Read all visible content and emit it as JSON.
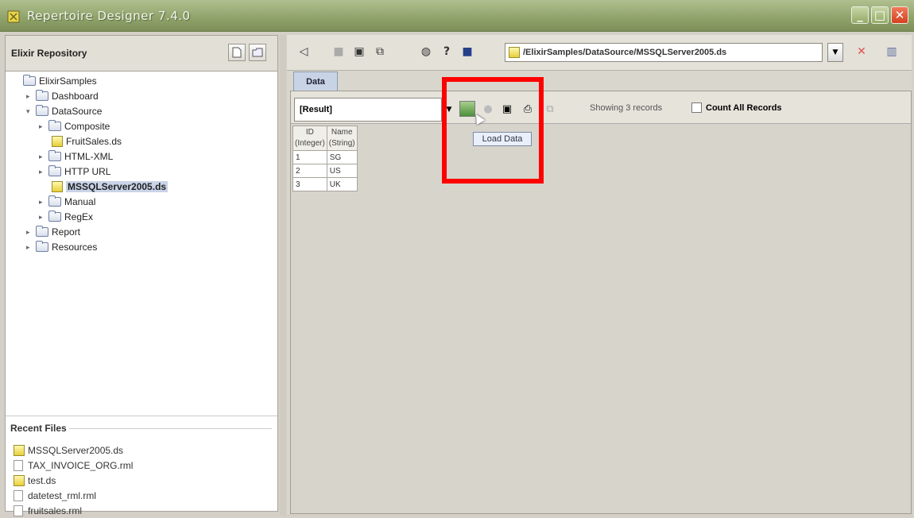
{
  "window": {
    "title": "Repertoire Designer 7.4.0",
    "controls": {
      "minimize": "_",
      "maximize": "□",
      "close": "✕"
    }
  },
  "left_panel": {
    "header": "Elixir Repository",
    "tree": [
      {
        "label": "ElixirSamples",
        "level": 0,
        "type": "folder",
        "expanded": true
      },
      {
        "label": "Dashboard",
        "level": 1,
        "type": "folder",
        "expanded": false
      },
      {
        "label": "DataSource",
        "level": 1,
        "type": "folder",
        "expanded": true
      },
      {
        "label": "Composite",
        "level": 2,
        "type": "folder",
        "expanded": false
      },
      {
        "label": "FruitSales.ds",
        "level": 3,
        "type": "ds"
      },
      {
        "label": "HTML-XML",
        "level": 2,
        "type": "folder",
        "expanded": false
      },
      {
        "label": "HTTP URL",
        "level": 2,
        "type": "folder",
        "expanded": false
      },
      {
        "label": "MSSQLServer2005.ds",
        "level": 3,
        "type": "ds",
        "selected": true
      },
      {
        "label": "Manual",
        "level": 2,
        "type": "folder",
        "expanded": false
      },
      {
        "label": "RegEx",
        "level": 2,
        "type": "folder",
        "expanded": false
      },
      {
        "label": "Report",
        "level": 1,
        "type": "folder",
        "expanded": false
      },
      {
        "label": "Resources",
        "level": 1,
        "type": "folder",
        "expanded": false
      }
    ],
    "recent_title": "Recent Files",
    "recent_files": [
      {
        "label": "MSSQLServer2005.ds",
        "type": "ds"
      },
      {
        "label": "TAX_INVOICE_ORG.rml",
        "type": "file"
      },
      {
        "label": "test.ds",
        "type": "ds"
      },
      {
        "label": "datetest_rml.rml",
        "type": "file"
      },
      {
        "label": "fruitsales.rml",
        "type": "file"
      }
    ]
  },
  "toolbar": {
    "path": "/ElixirSamples/DataSource/MSSQLServer2005.ds"
  },
  "tab": {
    "label": "Data"
  },
  "data_view": {
    "result_select": "[Result]",
    "showing": "Showing 3 records",
    "count_all_label": "Count All Records",
    "tooltip": "Load Data",
    "columns": [
      {
        "name": "ID",
        "type": "(Integer)"
      },
      {
        "name": "Name",
        "type": "(String)"
      }
    ],
    "rows": [
      [
        "1",
        "SG"
      ],
      [
        "2",
        "US"
      ],
      [
        "3",
        "UK"
      ]
    ]
  }
}
